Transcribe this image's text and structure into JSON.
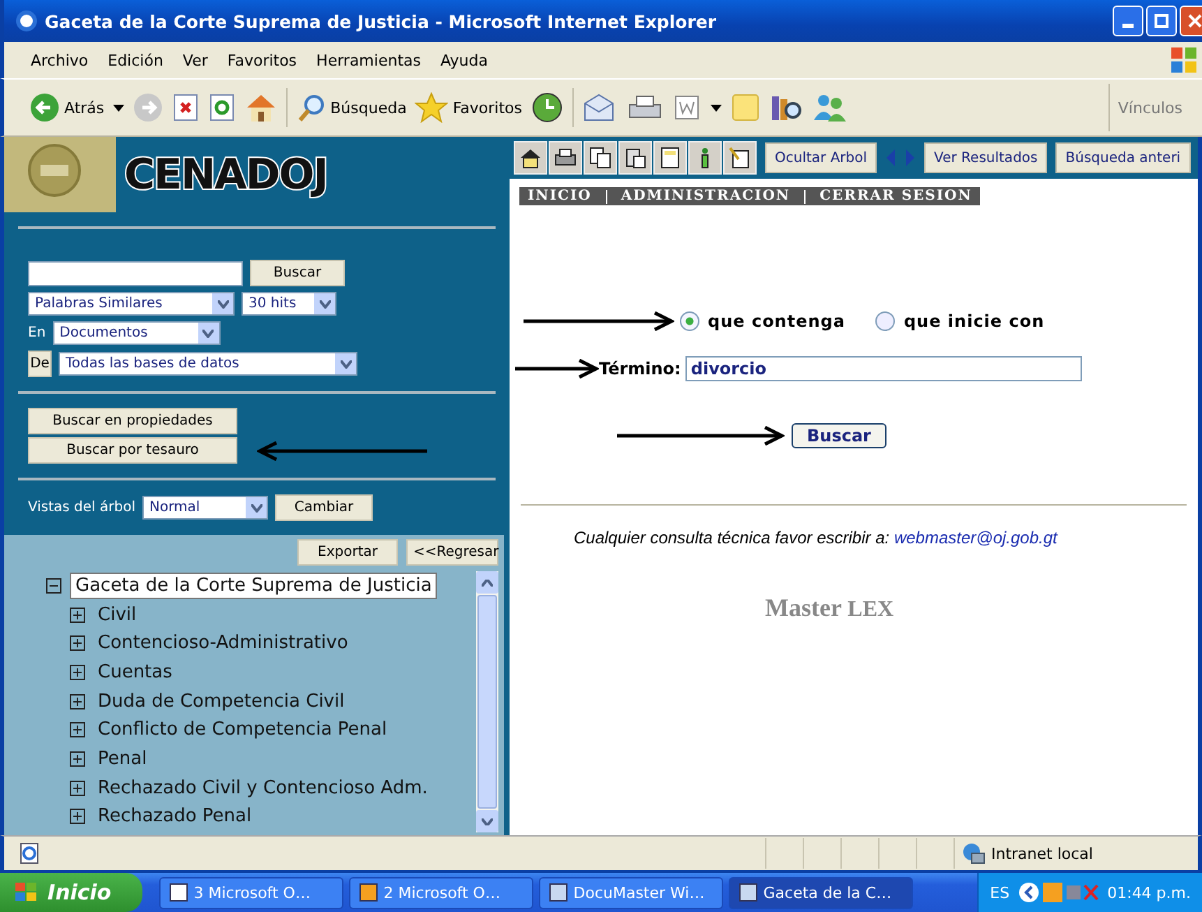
{
  "window": {
    "title": "Gaceta de la Corte Suprema de Justicia - Microsoft Internet Explorer"
  },
  "menu": [
    "Archivo",
    "Edición",
    "Ver",
    "Favoritos",
    "Herramientas",
    "Ayuda"
  ],
  "toolbar": {
    "back": "Atrás",
    "search": "Búsqueda",
    "favorites": "Favoritos",
    "links": "Vínculos"
  },
  "sidebar": {
    "logo": "CENADOJ",
    "search_button": "Buscar",
    "mode_select": "Palabras Similares",
    "hits_select": "30 hits",
    "in_label": "En",
    "in_select": "Documentos",
    "from_button": "De",
    "from_select": "Todas las bases de datos",
    "actions": [
      "Buscar en propiedades",
      "Buscar por tesauro"
    ],
    "view_label": "Vistas del árbol",
    "view_select": "Normal",
    "change_button": "Cambiar",
    "export_button": "Exportar",
    "back_button": "<<Regresar",
    "tree": [
      {
        "label": "Gaceta de la Corte Suprema de Justicia",
        "expanded": true,
        "selected": true,
        "children": [
          {
            "label": "Civil",
            "expanded": false,
            "selected": false
          },
          {
            "label": "Contencioso-Administrativo",
            "expanded": false,
            "selected": false
          },
          {
            "label": "Cuentas",
            "expanded": false,
            "selected": false
          },
          {
            "label": "Duda de Competencia Civil",
            "expanded": false,
            "selected": false
          },
          {
            "label": "Conflicto de Competencia Penal",
            "expanded": false,
            "selected": false
          },
          {
            "label": "Penal",
            "expanded": false,
            "selected": false
          },
          {
            "label": "Rechazado Civil y Contencioso Adm.",
            "expanded": false,
            "selected": false
          },
          {
            "label": "Rechazado Penal",
            "expanded": false,
            "selected": false
          }
        ]
      }
    ]
  },
  "content": {
    "tool_buttons": [
      "Ocultar Arbol",
      "Ver Resultados",
      "Búsqueda anteri"
    ],
    "nav": [
      "INICIO",
      "ADMINISTRACION",
      "CERRAR SESION"
    ],
    "radios": [
      {
        "label": "que contenga",
        "selected": true
      },
      {
        "label": "que inicie con",
        "selected": false
      }
    ],
    "term_label": "Término:",
    "term_value": "divorcio",
    "search_button": "Buscar",
    "contact_text": "Cualquier consulta técnica favor escribir a:",
    "contact_link": "webmaster@oj.gob.gt",
    "logo": {
      "main": "Master",
      "accent": "LEX"
    }
  },
  "status_bar": {
    "zone": "Intranet local"
  },
  "taskbar": {
    "start": "Inicio",
    "tasks": [
      {
        "label": "3 Microsoft O…",
        "selected": false
      },
      {
        "label": "2 Microsoft O…",
        "selected": false
      },
      {
        "label": "DocuMaster Wi…",
        "selected": false
      },
      {
        "label": "Gaceta de la C…",
        "selected": true
      }
    ],
    "language": "ES",
    "clock": "01:44 p.m."
  }
}
